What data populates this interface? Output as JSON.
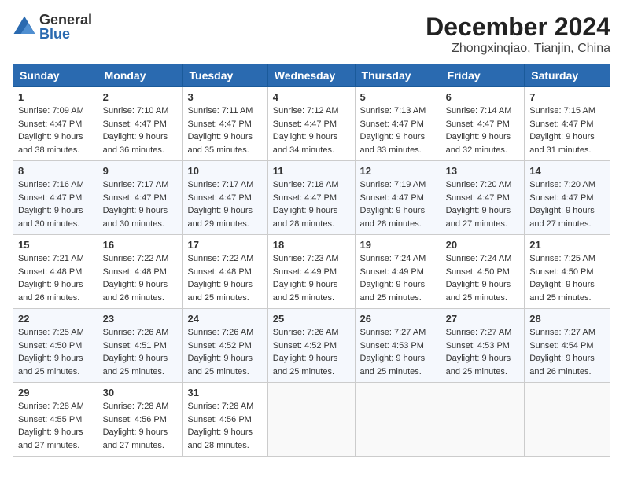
{
  "logo": {
    "general": "General",
    "blue": "Blue"
  },
  "header": {
    "title": "December 2024",
    "location": "Zhongxinqiao, Tianjin, China"
  },
  "days_of_week": [
    "Sunday",
    "Monday",
    "Tuesday",
    "Wednesday",
    "Thursday",
    "Friday",
    "Saturday"
  ],
  "weeks": [
    [
      {
        "day": "1",
        "sunrise": "7:09 AM",
        "sunset": "4:47 PM",
        "daylight": "9 hours and 38 minutes."
      },
      {
        "day": "2",
        "sunrise": "7:10 AM",
        "sunset": "4:47 PM",
        "daylight": "9 hours and 36 minutes."
      },
      {
        "day": "3",
        "sunrise": "7:11 AM",
        "sunset": "4:47 PM",
        "daylight": "9 hours and 35 minutes."
      },
      {
        "day": "4",
        "sunrise": "7:12 AM",
        "sunset": "4:47 PM",
        "daylight": "9 hours and 34 minutes."
      },
      {
        "day": "5",
        "sunrise": "7:13 AM",
        "sunset": "4:47 PM",
        "daylight": "9 hours and 33 minutes."
      },
      {
        "day": "6",
        "sunrise": "7:14 AM",
        "sunset": "4:47 PM",
        "daylight": "9 hours and 32 minutes."
      },
      {
        "day": "7",
        "sunrise": "7:15 AM",
        "sunset": "4:47 PM",
        "daylight": "9 hours and 31 minutes."
      }
    ],
    [
      {
        "day": "8",
        "sunrise": "7:16 AM",
        "sunset": "4:47 PM",
        "daylight": "9 hours and 30 minutes."
      },
      {
        "day": "9",
        "sunrise": "7:17 AM",
        "sunset": "4:47 PM",
        "daylight": "9 hours and 30 minutes."
      },
      {
        "day": "10",
        "sunrise": "7:17 AM",
        "sunset": "4:47 PM",
        "daylight": "9 hours and 29 minutes."
      },
      {
        "day": "11",
        "sunrise": "7:18 AM",
        "sunset": "4:47 PM",
        "daylight": "9 hours and 28 minutes."
      },
      {
        "day": "12",
        "sunrise": "7:19 AM",
        "sunset": "4:47 PM",
        "daylight": "9 hours and 28 minutes."
      },
      {
        "day": "13",
        "sunrise": "7:20 AM",
        "sunset": "4:47 PM",
        "daylight": "9 hours and 27 minutes."
      },
      {
        "day": "14",
        "sunrise": "7:20 AM",
        "sunset": "4:47 PM",
        "daylight": "9 hours and 27 minutes."
      }
    ],
    [
      {
        "day": "15",
        "sunrise": "7:21 AM",
        "sunset": "4:48 PM",
        "daylight": "9 hours and 26 minutes."
      },
      {
        "day": "16",
        "sunrise": "7:22 AM",
        "sunset": "4:48 PM",
        "daylight": "9 hours and 26 minutes."
      },
      {
        "day": "17",
        "sunrise": "7:22 AM",
        "sunset": "4:48 PM",
        "daylight": "9 hours and 25 minutes."
      },
      {
        "day": "18",
        "sunrise": "7:23 AM",
        "sunset": "4:49 PM",
        "daylight": "9 hours and 25 minutes."
      },
      {
        "day": "19",
        "sunrise": "7:24 AM",
        "sunset": "4:49 PM",
        "daylight": "9 hours and 25 minutes."
      },
      {
        "day": "20",
        "sunrise": "7:24 AM",
        "sunset": "4:50 PM",
        "daylight": "9 hours and 25 minutes."
      },
      {
        "day": "21",
        "sunrise": "7:25 AM",
        "sunset": "4:50 PM",
        "daylight": "9 hours and 25 minutes."
      }
    ],
    [
      {
        "day": "22",
        "sunrise": "7:25 AM",
        "sunset": "4:50 PM",
        "daylight": "9 hours and 25 minutes."
      },
      {
        "day": "23",
        "sunrise": "7:26 AM",
        "sunset": "4:51 PM",
        "daylight": "9 hours and 25 minutes."
      },
      {
        "day": "24",
        "sunrise": "7:26 AM",
        "sunset": "4:52 PM",
        "daylight": "9 hours and 25 minutes."
      },
      {
        "day": "25",
        "sunrise": "7:26 AM",
        "sunset": "4:52 PM",
        "daylight": "9 hours and 25 minutes."
      },
      {
        "day": "26",
        "sunrise": "7:27 AM",
        "sunset": "4:53 PM",
        "daylight": "9 hours and 25 minutes."
      },
      {
        "day": "27",
        "sunrise": "7:27 AM",
        "sunset": "4:53 PM",
        "daylight": "9 hours and 25 minutes."
      },
      {
        "day": "28",
        "sunrise": "7:27 AM",
        "sunset": "4:54 PM",
        "daylight": "9 hours and 26 minutes."
      }
    ],
    [
      {
        "day": "29",
        "sunrise": "7:28 AM",
        "sunset": "4:55 PM",
        "daylight": "9 hours and 27 minutes."
      },
      {
        "day": "30",
        "sunrise": "7:28 AM",
        "sunset": "4:56 PM",
        "daylight": "9 hours and 27 minutes."
      },
      {
        "day": "31",
        "sunrise": "7:28 AM",
        "sunset": "4:56 PM",
        "daylight": "9 hours and 28 minutes."
      },
      null,
      null,
      null,
      null
    ]
  ],
  "labels": {
    "sunrise": "Sunrise:",
    "sunset": "Sunset:",
    "daylight": "Daylight:"
  }
}
